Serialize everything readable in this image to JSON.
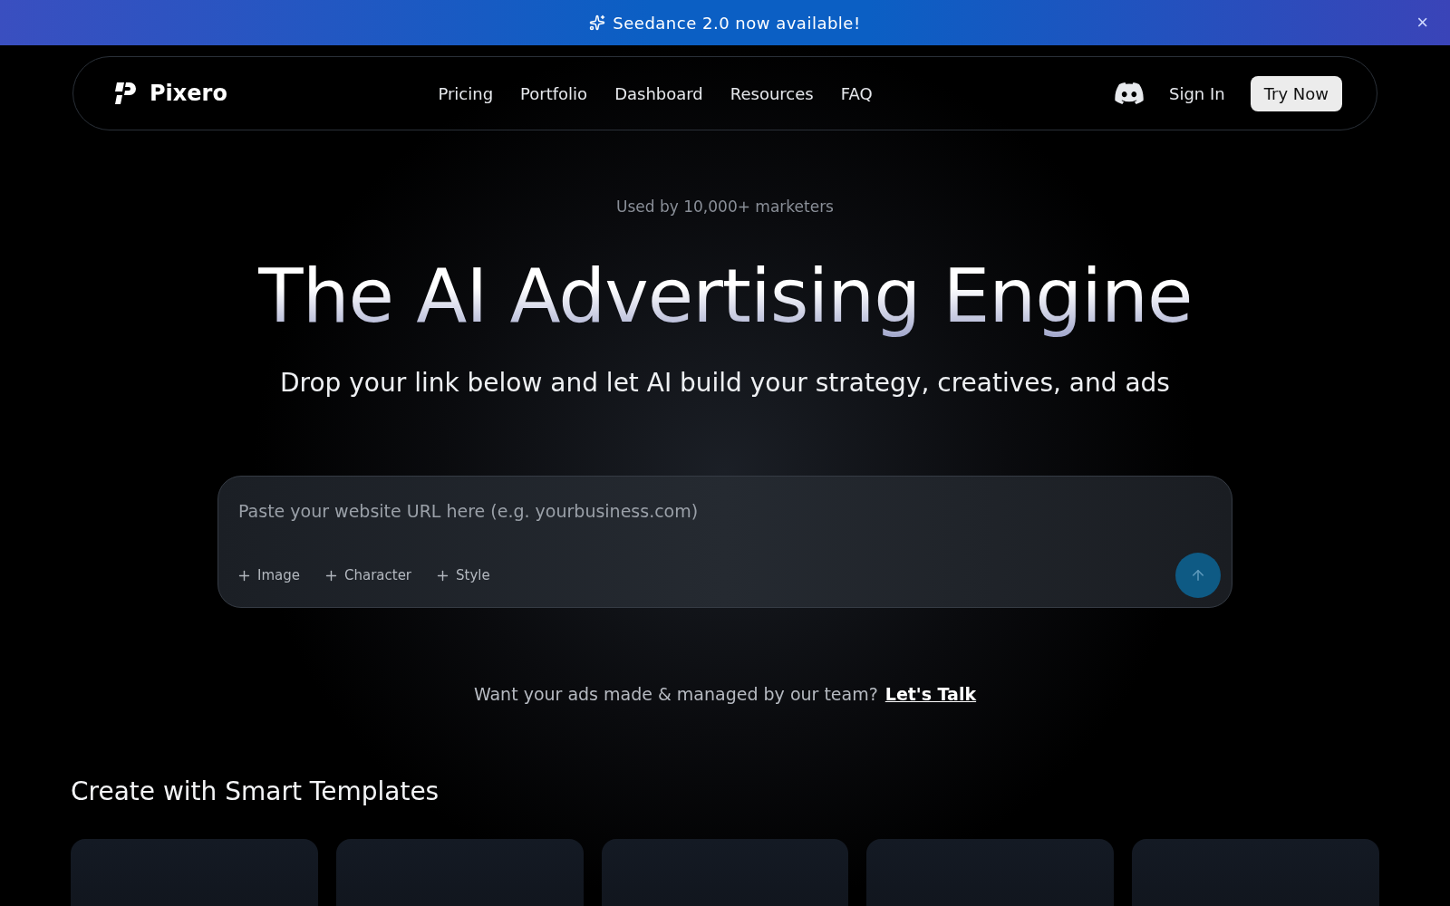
{
  "banner": {
    "text": "Seedance 2.0 now available!",
    "close": "×"
  },
  "nav": {
    "brand": "Pixero",
    "links": [
      "Pricing",
      "Portfolio",
      "Dashboard",
      "Resources",
      "FAQ"
    ],
    "sign_in": "Sign In",
    "cta": "Try Now"
  },
  "hero": {
    "eyebrow": "Used by 10,000+ marketers",
    "title": "The AI Advertising Engine",
    "subtitle": "Drop your link below and let AI build your strategy, creatives, and ads"
  },
  "prompt": {
    "placeholder": "Paste your website URL here (e.g. yourbusiness.com)",
    "attachments": [
      "Image",
      "Character",
      "Style"
    ]
  },
  "contact": {
    "text": "Want your ads made & managed by our team?",
    "link": "Let's Talk"
  },
  "templates": {
    "title": "Create with Smart Templates"
  }
}
